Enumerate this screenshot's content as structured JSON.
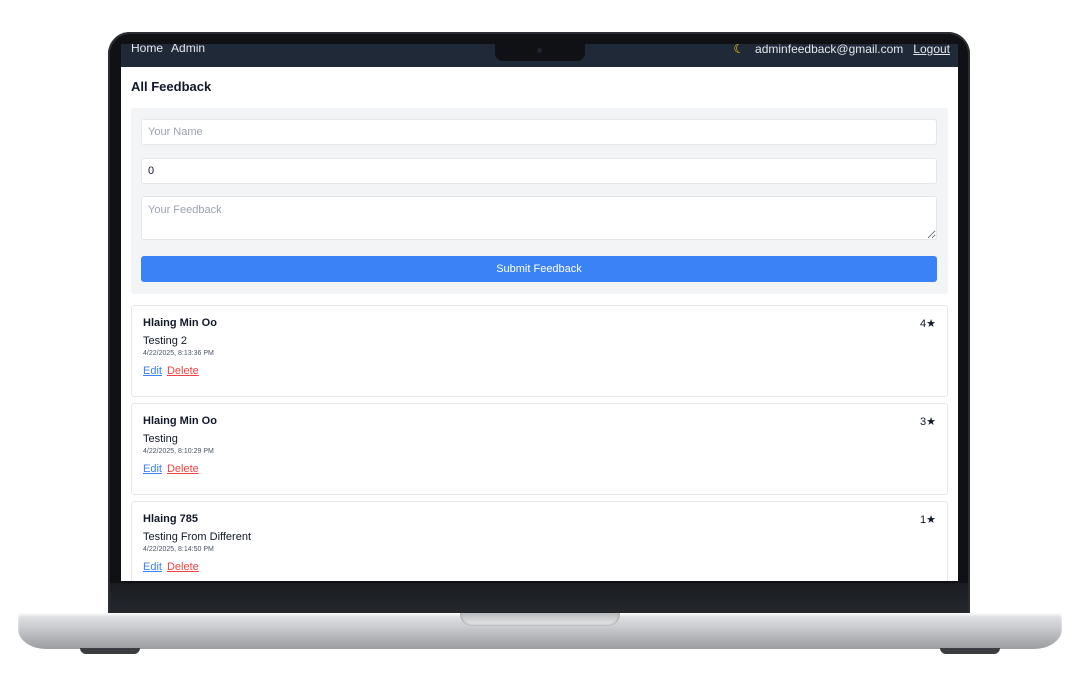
{
  "navbar": {
    "links": [
      "Home",
      "Admin"
    ],
    "user_email": "adminfeedback@gmail.com",
    "logout_label": "Logout",
    "theme_icon": "moon-icon"
  },
  "page": {
    "title": "All Feedback"
  },
  "form": {
    "name_placeholder": "Your Name",
    "name_value": "",
    "rating_value": "0",
    "feedback_placeholder": "Your Feedback",
    "submit_label": "Submit Feedback"
  },
  "feedback": [
    {
      "name": "Hlaing Min Oo",
      "text": "Testing 2",
      "date": "4/22/2025, 8:13:36 PM",
      "rating": "4★",
      "edit_label": "Edit",
      "delete_label": "Delete"
    },
    {
      "name": "Hlaing Min Oo",
      "text": "Testing",
      "date": "4/22/2025, 8:10:29 PM",
      "rating": "3★",
      "edit_label": "Edit",
      "delete_label": "Delete"
    },
    {
      "name": "Hlaing 785",
      "text": "Testing From Different",
      "date": "4/22/2025, 8:14:50 PM",
      "rating": "1★",
      "edit_label": "Edit",
      "delete_label": "Delete"
    }
  ],
  "colors": {
    "navbar_bg": "#1f2937",
    "primary": "#3b82f6",
    "danger": "#ef4444",
    "form_bg": "#f3f4f6"
  }
}
